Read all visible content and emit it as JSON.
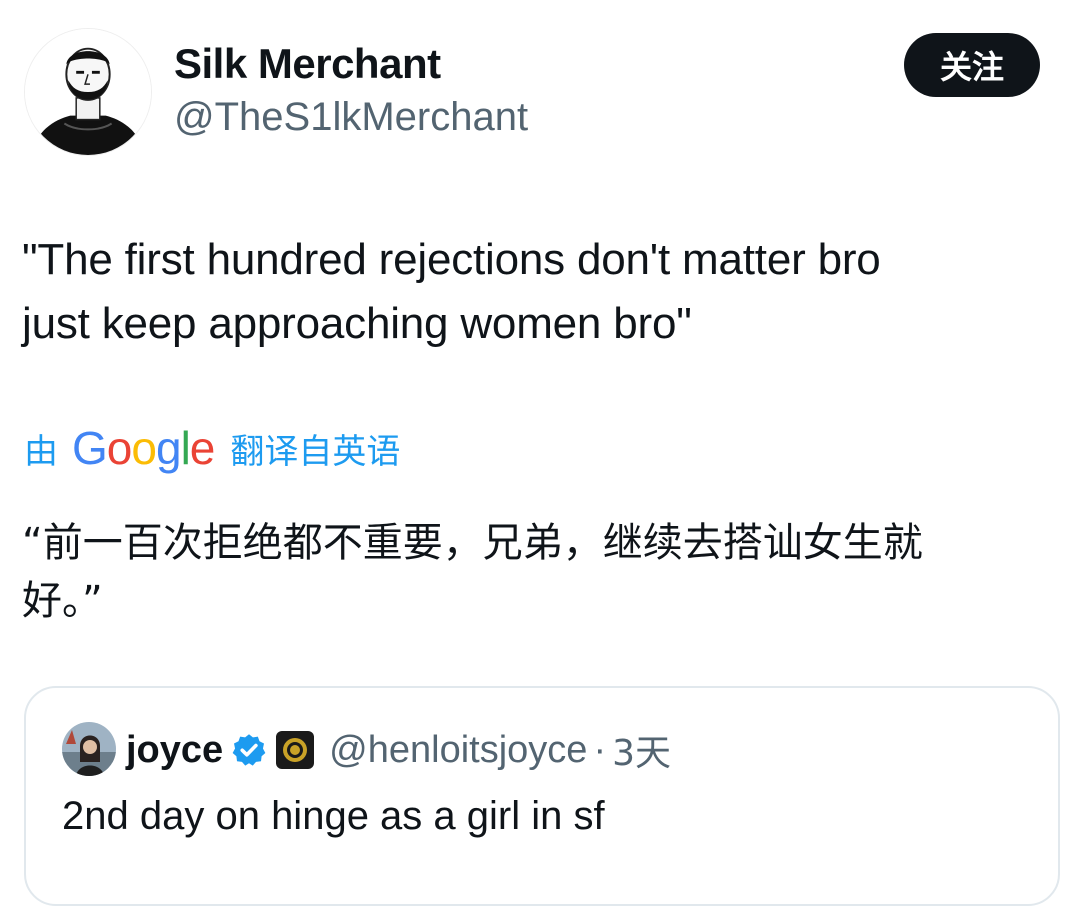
{
  "author": {
    "display_name": "Silk Merchant",
    "handle": "@TheS1lkMerchant",
    "avatar_icon": "bearded-man-illustration"
  },
  "follow_button": {
    "label": "关注"
  },
  "tweet": {
    "line1": "\"The first hundred rejections don't matter bro",
    "line2": "just keep approaching women bro\""
  },
  "translation": {
    "prefix": "由",
    "provider": "Google",
    "suffix": "翻译自英语",
    "line1": "“前一百次拒绝都不重要，兄弟，继续去搭讪女生就",
    "line2": "好。”"
  },
  "quoted_tweet": {
    "name": "joyce",
    "handle": "@henloitsjoyce",
    "separator": "·",
    "time": "3天",
    "text": "2nd day on hinge as a girl in sf",
    "verified_color": "#1d9bf0"
  },
  "colors": {
    "text_primary": "#0f1419",
    "text_secondary": "#536471",
    "accent": "#1d9bf0",
    "button_bg": "#0f1419"
  }
}
